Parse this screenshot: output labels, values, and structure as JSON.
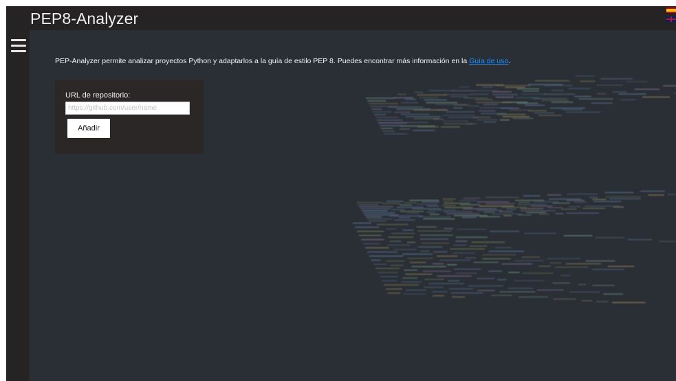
{
  "header": {
    "title": "PEP8-Analyzer"
  },
  "languages": [
    {
      "name": "es-flag-icon"
    },
    {
      "name": "uk-flag-icon"
    }
  ],
  "sidebar": {
    "menu_icon": "hamburger-menu-icon"
  },
  "intro": {
    "text": "PEP-Analyzer permite analizar proyectos Python y adaptarlos a la guía de estilo PEP 8. Puedes encontrar más información en la ",
    "link_text": "Guía de uso",
    "suffix": "."
  },
  "form": {
    "label": "URL de repositorio:",
    "input_value": "",
    "input_placeholder": "https://github.com/user/name",
    "button_label": "Añadir"
  },
  "colors": {
    "header_bg": "#252323",
    "main_bg": "#2a2e35",
    "panel_bg": "#2a2726",
    "link": "#1e90ff"
  }
}
